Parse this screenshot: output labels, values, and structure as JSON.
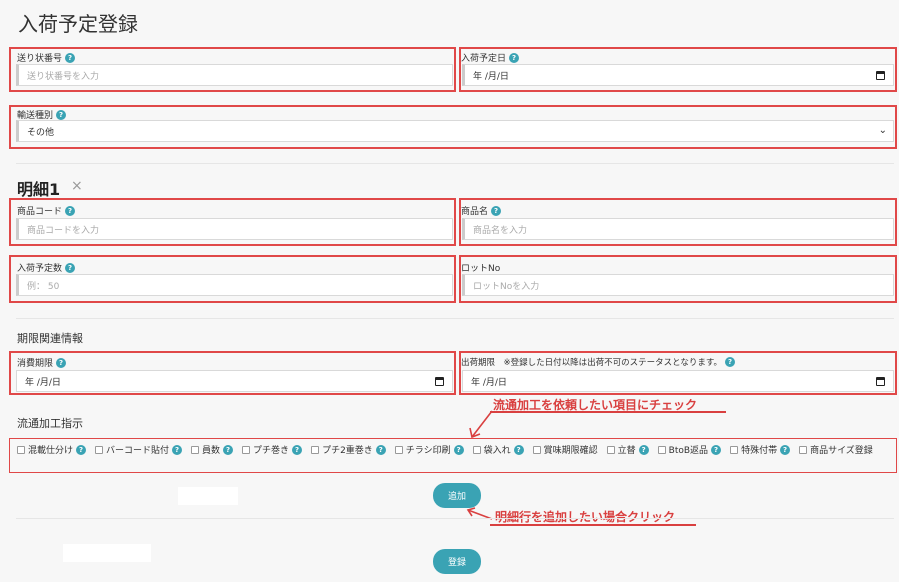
{
  "title": "入荷予定登録",
  "fields": {
    "tracking": {
      "label": "送り状番号",
      "placeholder": "送り状番号を入力"
    },
    "arrival_date": {
      "label": "入荷予定日",
      "value": "年 /月/日"
    },
    "shipping_type": {
      "label": "輸送種別",
      "value": "その他"
    }
  },
  "detail": {
    "title": "明細1",
    "close": "×",
    "product_code": {
      "label": "商品コード",
      "placeholder": "商品コードを入力"
    },
    "product_name": {
      "label": "商品名",
      "placeholder": "商品名を入力"
    },
    "qty": {
      "label": "入荷予定数",
      "placeholder": "例： 50"
    },
    "lot": {
      "label": "ロットNo",
      "placeholder": "ロットNoを入力"
    }
  },
  "expiry_section": {
    "title": "期限関連情報",
    "consume": {
      "label": "消費期限",
      "value": "年 /月/日"
    },
    "shipping_limit": {
      "label": "出荷期限　※登録した日付以降は出荷不可のステータスとなります。",
      "value": "年 /月/日"
    }
  },
  "processing": {
    "title": "流通加工指示",
    "options": [
      "混載仕分け",
      "バーコード貼付",
      "員数",
      "プチ巻き",
      "プチ2重巻き",
      "チラシ印刷",
      "袋入れ",
      "賞味期限確認",
      "立替",
      "BtoB返品",
      "特殊付帯",
      "商品サイズ登録"
    ]
  },
  "annotations": {
    "check_note": "流通加工を依頼したい項目にチェック",
    "add_note": "明細行を追加したい場合クリック"
  },
  "buttons": {
    "add": "追加",
    "register": "登録"
  },
  "help_glyph": "?",
  "colors": {
    "accent": "#3aa3b4",
    "highlight": "#e04848",
    "annotation": "#d94040"
  }
}
